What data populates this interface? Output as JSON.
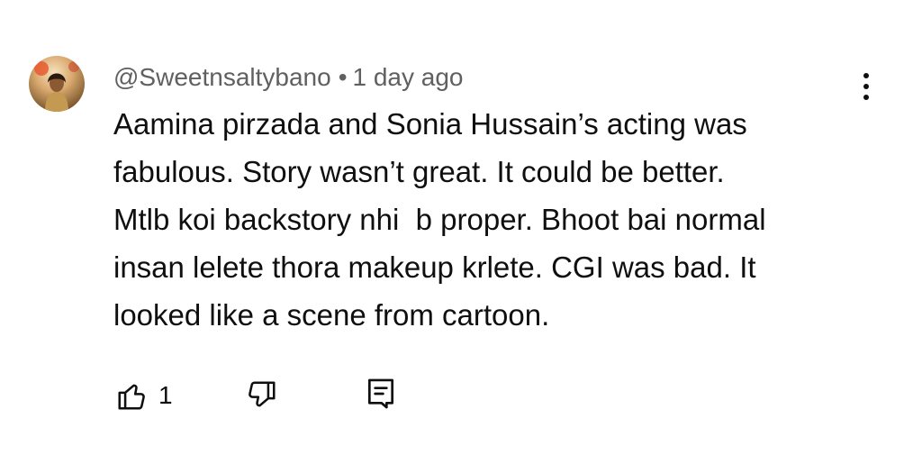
{
  "comment": {
    "author": "@Sweetnsaltybano",
    "separator": "•",
    "timestamp": "1 day ago",
    "text_lines": [
      "Aamina pirzada and Sonia Hussain’s acting was",
      "fabulous. Story wasn’t great. It could be better.",
      "Mtlb koi backstory nhi  b proper. Bhoot bai normal",
      "insan lelete thora makeup krlete. CGI was bad. It",
      "looked like a scene from cartoon."
    ],
    "like_count": "1"
  },
  "icons": {
    "avatar": "avatar-photo",
    "more": "more-vertical-icon",
    "like": "thumbs-up-icon",
    "dislike": "thumbs-down-icon",
    "reply": "reply-comment-icon"
  },
  "colors": {
    "text": "#0f0f0f",
    "secondary_text": "#606060",
    "background": "#ffffff"
  }
}
